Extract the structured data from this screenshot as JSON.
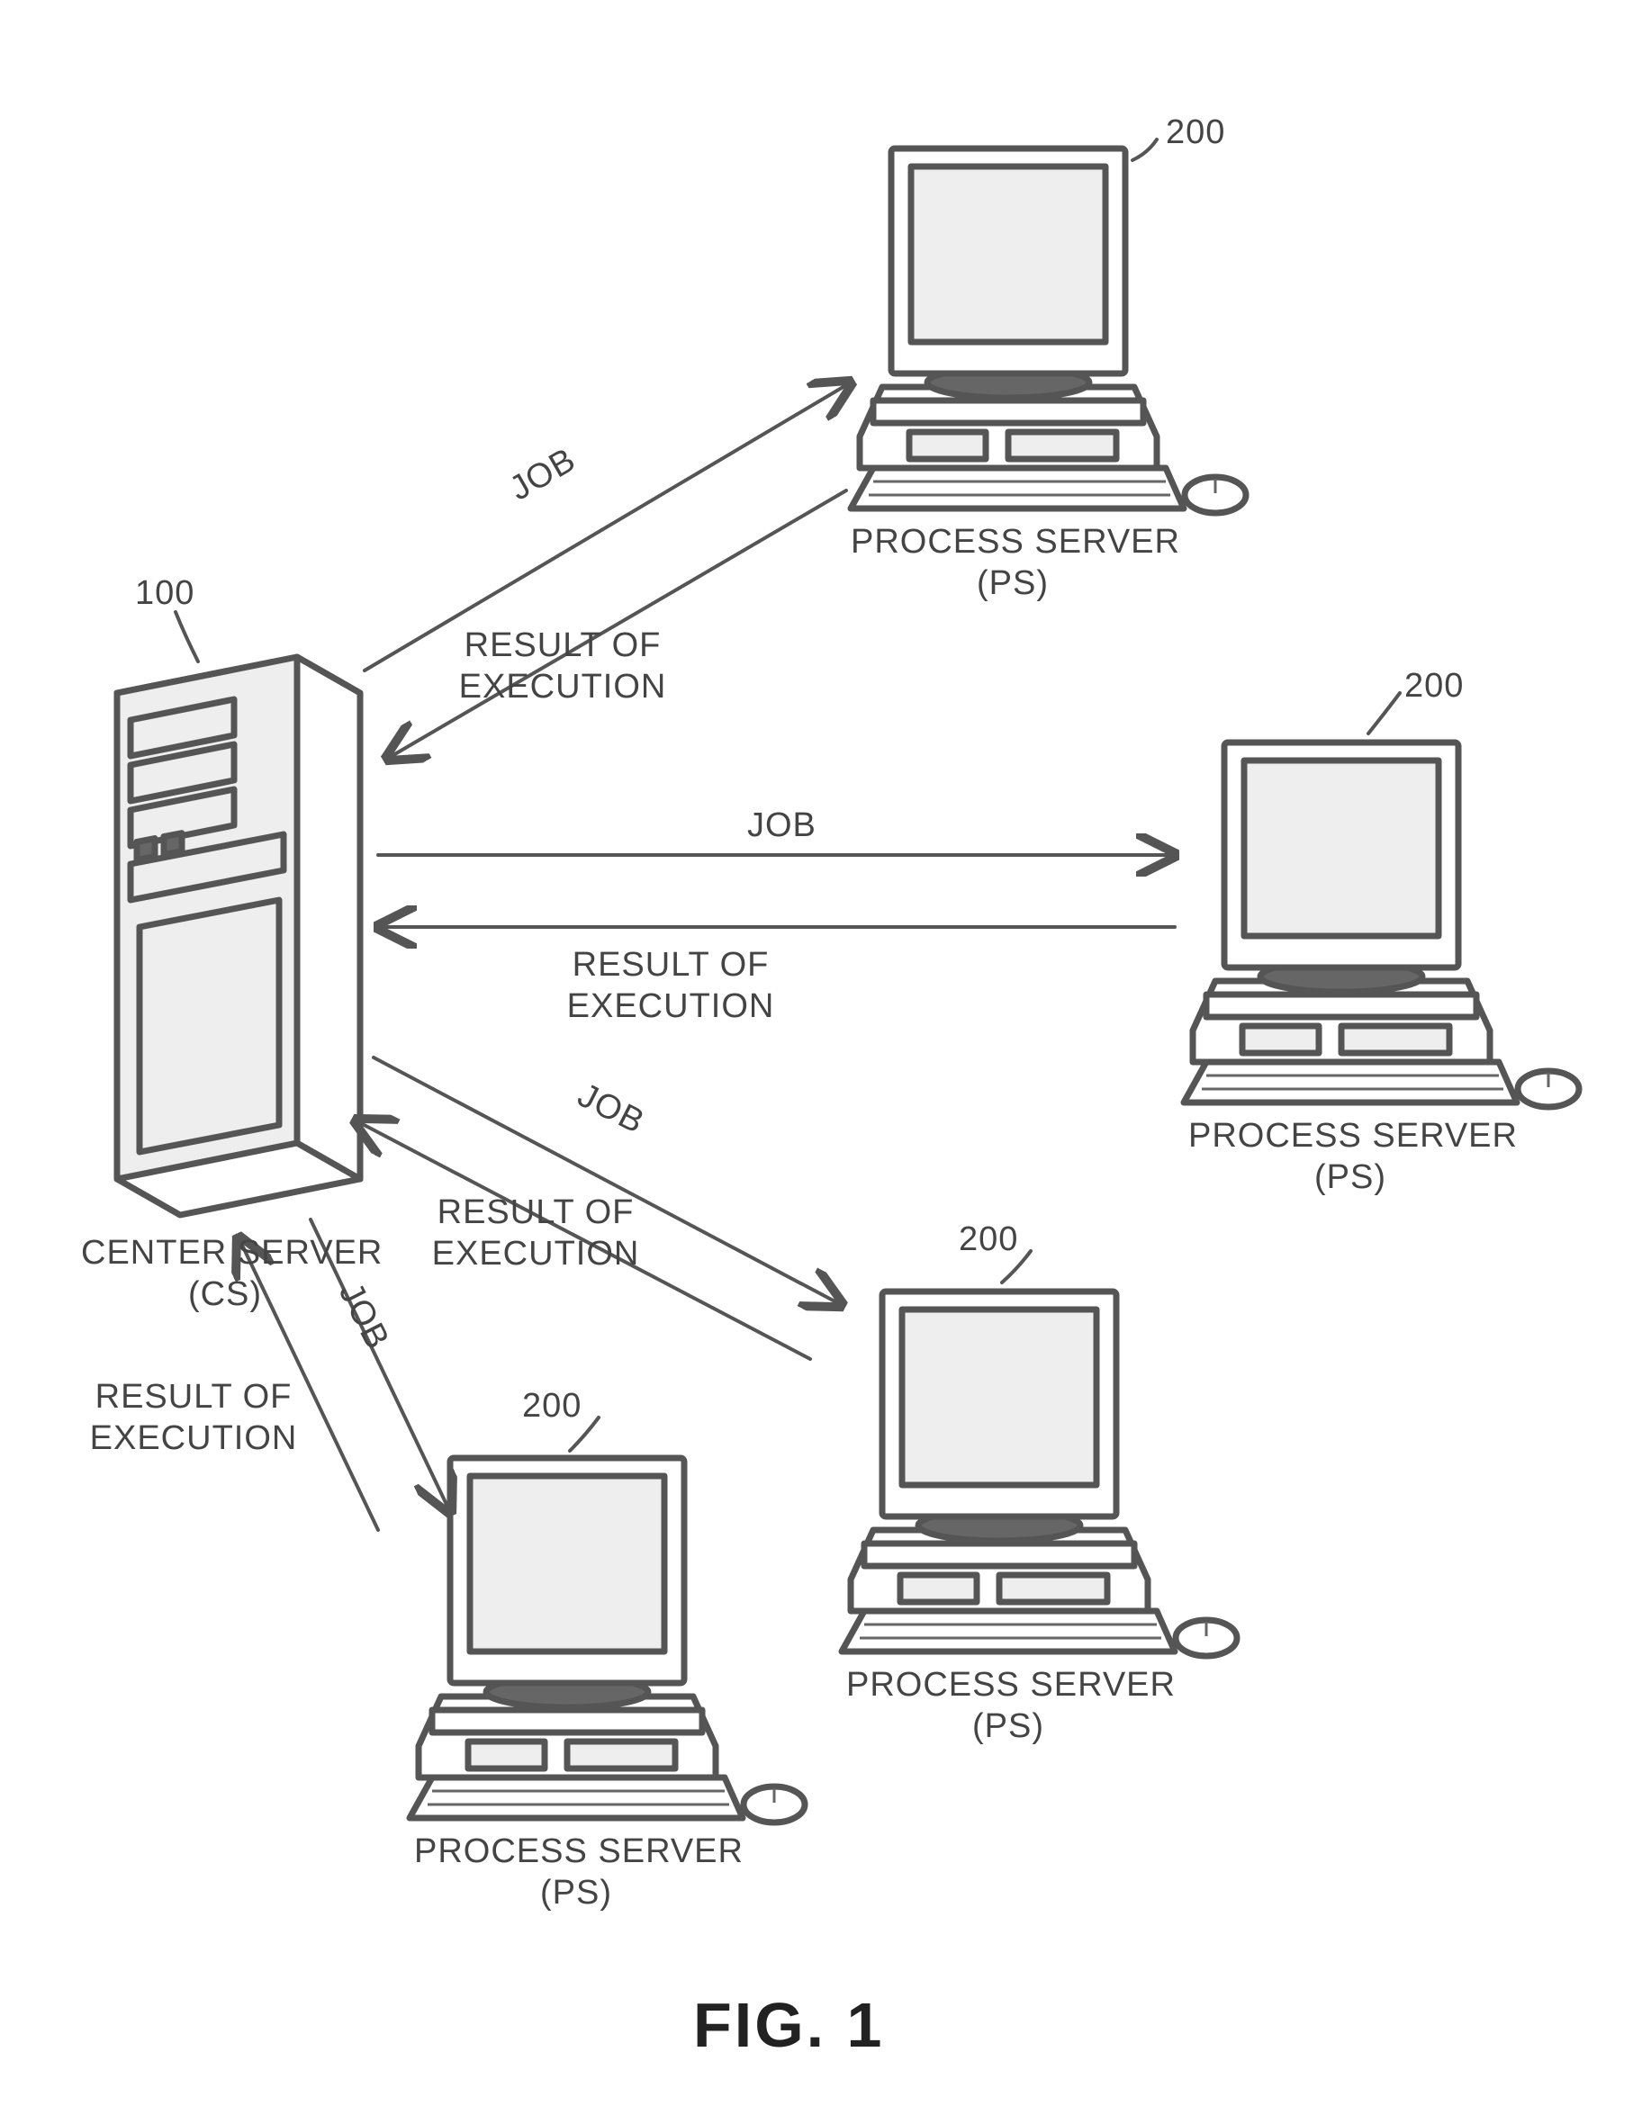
{
  "figure_caption": "FIG. 1",
  "center_server": {
    "ref": "100",
    "label": "CENTER SERVER\n(CS)"
  },
  "process_servers": [
    {
      "ref": "200",
      "label": "PROCESS SERVER\n(PS)"
    },
    {
      "ref": "200",
      "label": "PROCESS SERVER\n(PS)"
    },
    {
      "ref": "200",
      "label": "PROCESS SERVER\n(PS)"
    },
    {
      "ref": "200",
      "label": "PROCESS SERVER\n(PS)"
    }
  ],
  "link_labels": {
    "job": "JOB",
    "result": "RESULT OF\nEXECUTION"
  }
}
